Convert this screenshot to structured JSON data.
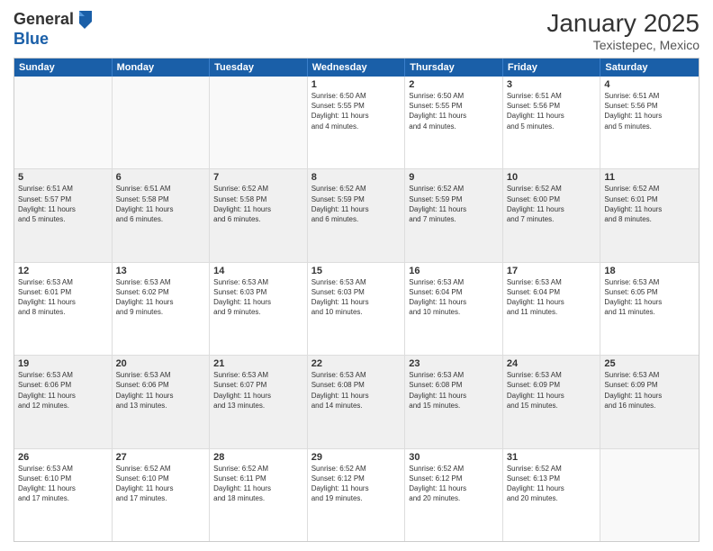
{
  "header": {
    "logo_general": "General",
    "logo_blue": "Blue",
    "month_title": "January 2025",
    "subtitle": "Texistepec, Mexico"
  },
  "days_of_week": [
    "Sunday",
    "Monday",
    "Tuesday",
    "Wednesday",
    "Thursday",
    "Friday",
    "Saturday"
  ],
  "rows": [
    {
      "cells": [
        {
          "empty": true
        },
        {
          "empty": true
        },
        {
          "empty": true
        },
        {
          "day": "1",
          "lines": [
            "Sunrise: 6:50 AM",
            "Sunset: 5:55 PM",
            "Daylight: 11 hours",
            "and 4 minutes."
          ]
        },
        {
          "day": "2",
          "lines": [
            "Sunrise: 6:50 AM",
            "Sunset: 5:55 PM",
            "Daylight: 11 hours",
            "and 4 minutes."
          ]
        },
        {
          "day": "3",
          "lines": [
            "Sunrise: 6:51 AM",
            "Sunset: 5:56 PM",
            "Daylight: 11 hours",
            "and 5 minutes."
          ]
        },
        {
          "day": "4",
          "lines": [
            "Sunrise: 6:51 AM",
            "Sunset: 5:56 PM",
            "Daylight: 11 hours",
            "and 5 minutes."
          ]
        }
      ]
    },
    {
      "cells": [
        {
          "day": "5",
          "lines": [
            "Sunrise: 6:51 AM",
            "Sunset: 5:57 PM",
            "Daylight: 11 hours",
            "and 5 minutes."
          ]
        },
        {
          "day": "6",
          "lines": [
            "Sunrise: 6:51 AM",
            "Sunset: 5:58 PM",
            "Daylight: 11 hours",
            "and 6 minutes."
          ]
        },
        {
          "day": "7",
          "lines": [
            "Sunrise: 6:52 AM",
            "Sunset: 5:58 PM",
            "Daylight: 11 hours",
            "and 6 minutes."
          ]
        },
        {
          "day": "8",
          "lines": [
            "Sunrise: 6:52 AM",
            "Sunset: 5:59 PM",
            "Daylight: 11 hours",
            "and 6 minutes."
          ]
        },
        {
          "day": "9",
          "lines": [
            "Sunrise: 6:52 AM",
            "Sunset: 5:59 PM",
            "Daylight: 11 hours",
            "and 7 minutes."
          ]
        },
        {
          "day": "10",
          "lines": [
            "Sunrise: 6:52 AM",
            "Sunset: 6:00 PM",
            "Daylight: 11 hours",
            "and 7 minutes."
          ]
        },
        {
          "day": "11",
          "lines": [
            "Sunrise: 6:52 AM",
            "Sunset: 6:01 PM",
            "Daylight: 11 hours",
            "and 8 minutes."
          ]
        }
      ]
    },
    {
      "cells": [
        {
          "day": "12",
          "lines": [
            "Sunrise: 6:53 AM",
            "Sunset: 6:01 PM",
            "Daylight: 11 hours",
            "and 8 minutes."
          ]
        },
        {
          "day": "13",
          "lines": [
            "Sunrise: 6:53 AM",
            "Sunset: 6:02 PM",
            "Daylight: 11 hours",
            "and 9 minutes."
          ]
        },
        {
          "day": "14",
          "lines": [
            "Sunrise: 6:53 AM",
            "Sunset: 6:03 PM",
            "Daylight: 11 hours",
            "and 9 minutes."
          ]
        },
        {
          "day": "15",
          "lines": [
            "Sunrise: 6:53 AM",
            "Sunset: 6:03 PM",
            "Daylight: 11 hours",
            "and 10 minutes."
          ]
        },
        {
          "day": "16",
          "lines": [
            "Sunrise: 6:53 AM",
            "Sunset: 6:04 PM",
            "Daylight: 11 hours",
            "and 10 minutes."
          ]
        },
        {
          "day": "17",
          "lines": [
            "Sunrise: 6:53 AM",
            "Sunset: 6:04 PM",
            "Daylight: 11 hours",
            "and 11 minutes."
          ]
        },
        {
          "day": "18",
          "lines": [
            "Sunrise: 6:53 AM",
            "Sunset: 6:05 PM",
            "Daylight: 11 hours",
            "and 11 minutes."
          ]
        }
      ]
    },
    {
      "cells": [
        {
          "day": "19",
          "lines": [
            "Sunrise: 6:53 AM",
            "Sunset: 6:06 PM",
            "Daylight: 11 hours",
            "and 12 minutes."
          ]
        },
        {
          "day": "20",
          "lines": [
            "Sunrise: 6:53 AM",
            "Sunset: 6:06 PM",
            "Daylight: 11 hours",
            "and 13 minutes."
          ]
        },
        {
          "day": "21",
          "lines": [
            "Sunrise: 6:53 AM",
            "Sunset: 6:07 PM",
            "Daylight: 11 hours",
            "and 13 minutes."
          ]
        },
        {
          "day": "22",
          "lines": [
            "Sunrise: 6:53 AM",
            "Sunset: 6:08 PM",
            "Daylight: 11 hours",
            "and 14 minutes."
          ]
        },
        {
          "day": "23",
          "lines": [
            "Sunrise: 6:53 AM",
            "Sunset: 6:08 PM",
            "Daylight: 11 hours",
            "and 15 minutes."
          ]
        },
        {
          "day": "24",
          "lines": [
            "Sunrise: 6:53 AM",
            "Sunset: 6:09 PM",
            "Daylight: 11 hours",
            "and 15 minutes."
          ]
        },
        {
          "day": "25",
          "lines": [
            "Sunrise: 6:53 AM",
            "Sunset: 6:09 PM",
            "Daylight: 11 hours",
            "and 16 minutes."
          ]
        }
      ]
    },
    {
      "cells": [
        {
          "day": "26",
          "lines": [
            "Sunrise: 6:53 AM",
            "Sunset: 6:10 PM",
            "Daylight: 11 hours",
            "and 17 minutes."
          ]
        },
        {
          "day": "27",
          "lines": [
            "Sunrise: 6:52 AM",
            "Sunset: 6:10 PM",
            "Daylight: 11 hours",
            "and 17 minutes."
          ]
        },
        {
          "day": "28",
          "lines": [
            "Sunrise: 6:52 AM",
            "Sunset: 6:11 PM",
            "Daylight: 11 hours",
            "and 18 minutes."
          ]
        },
        {
          "day": "29",
          "lines": [
            "Sunrise: 6:52 AM",
            "Sunset: 6:12 PM",
            "Daylight: 11 hours",
            "and 19 minutes."
          ]
        },
        {
          "day": "30",
          "lines": [
            "Sunrise: 6:52 AM",
            "Sunset: 6:12 PM",
            "Daylight: 11 hours",
            "and 20 minutes."
          ]
        },
        {
          "day": "31",
          "lines": [
            "Sunrise: 6:52 AM",
            "Sunset: 6:13 PM",
            "Daylight: 11 hours",
            "and 20 minutes."
          ]
        },
        {
          "empty": true
        }
      ]
    }
  ]
}
